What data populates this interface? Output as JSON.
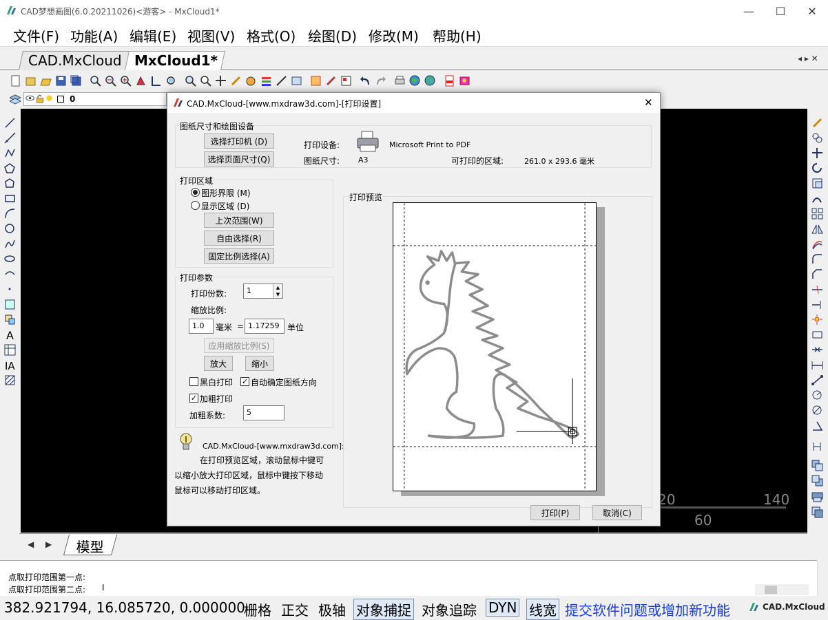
{
  "window": {
    "title": "CAD梦想画图(6.0.20211026)<游客> - MxCloud1*",
    "minimize": "—",
    "maximize": "☐",
    "close": "✕"
  },
  "menu": [
    {
      "label": "文件(F)"
    },
    {
      "label": "功能(A)"
    },
    {
      "label": "编辑(E)"
    },
    {
      "label": "视图(V)"
    },
    {
      "label": "格式(O)"
    },
    {
      "label": "绘图(D)"
    },
    {
      "label": "修改(M)"
    },
    {
      "label": "帮助(H)"
    }
  ],
  "tabs": [
    {
      "label": "CAD.MxCloud",
      "active": false
    },
    {
      "label": "MxCloud1*",
      "active": true
    }
  ],
  "tab_nav": "◂ ▸ ✕",
  "layer": {
    "value": "0"
  },
  "canvas_labels": {
    "a": "20",
    "b": "140",
    "c": "60"
  },
  "model_tab": {
    "label": "模型",
    "prev": "◀",
    "next": "▶"
  },
  "command": {
    "line1": "点取打印范围第一点:",
    "line2": "点取打印范围第二点:",
    "cursor": "I"
  },
  "status": {
    "coords": "382.921794,  16.085720,  0.000000",
    "items": [
      "栅格",
      "正交",
      "极轴"
    ],
    "toggles": [
      "对象捕捉"
    ],
    "track": "对象追踪",
    "dyn": "DYN",
    "lw": "线宽",
    "link": "提交软件问题或增加新功能",
    "brand": "CAD.MxCloud",
    "colors": {
      "link": "#1a3fd6",
      "toggle_bg": "#dfe9f7"
    }
  },
  "dialog": {
    "title": "CAD.MxCloud-[www.mxdraw3d.com]-[打印设置]",
    "close": "✕",
    "paper_group": {
      "label": "图纸尺寸和绘图设备",
      "select_printer": "选择打印机 (D)",
      "select_page": "选择页面尺寸(Q)",
      "device_label": "打印设备:",
      "device_value": "Microsoft Print to PDF",
      "size_label": "图纸尺寸:",
      "size_value": "A3",
      "printable_label": "可打印的区域:",
      "printable_value": "261.0 x 293.6 毫米"
    },
    "area_group": {
      "label": "打印区域",
      "radio_limits": "图形界限 (M)",
      "radio_display": "显示区域 (D)",
      "last_range": "上次范围(W)",
      "free_select": "自由选择(R)",
      "fixed_ratio": "固定比例选择(A)"
    },
    "params_group": {
      "label": "打印参数",
      "copies_label": "打印份数:",
      "copies_value": "1",
      "scale_label": "缩放比例:",
      "scale_mm": "1.0",
      "mm_unit": "毫米",
      "equals": "=",
      "scale_units": "1.17259",
      "units_label": "单位",
      "apply_scale": "应用缩放比例(S)",
      "zoom_in": "放大",
      "zoom_out": "缩小",
      "bw_print": "黑白打印",
      "auto_orient": "自动确定图纸方向",
      "bold_print": "加粗打印",
      "bold_factor_label": "加粗系数:",
      "bold_factor_value": "5"
    },
    "tip": {
      "line1": "CAD.MxCloud-[www.mxdraw3d.com]:",
      "line2": "在打印预览区域，滚动鼠标中键可",
      "line3": "以缩小放大打印区域，鼠标中键按下移动",
      "line4": "鼠标可以移动打印区域。"
    },
    "preview_label": "打印预览",
    "print_button": "打印(P)",
    "cancel_button": "取消(C)"
  }
}
